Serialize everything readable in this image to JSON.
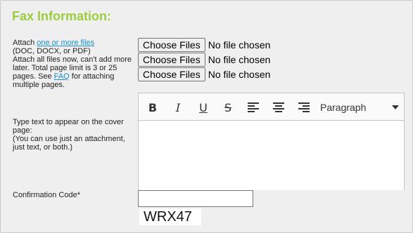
{
  "section": {
    "title": "Fax Information:"
  },
  "attach": {
    "prefix": "Attach ",
    "link": "one or more files",
    "formats": "(DOC, DOCX, or PDF)",
    "note_before_link": "Attach all files now, can't add more later. Total page limit is 3 or 25 pages. See ",
    "faq_link": "FAQ",
    "note_after_link": " for attaching multiple pages."
  },
  "files": [
    {
      "button_label": "Choose Files",
      "status": "No file chosen"
    },
    {
      "button_label": "Choose Files",
      "status": "No file chosen"
    },
    {
      "button_label": "Choose Files",
      "status": "No file chosen"
    }
  ],
  "cover": {
    "label_line1": "Type text to appear on the cover page:",
    "label_line2": "(You can use just an attachment, just text, or both.)"
  },
  "editor": {
    "toolbar": {
      "bold": "B",
      "italic": "I",
      "underline": "U",
      "strike": "S",
      "paragraph": "Paragraph"
    },
    "icons": [
      "bold-icon",
      "italic-icon",
      "underline-icon",
      "strikethrough-icon",
      "align-left-icon",
      "align-center-icon",
      "align-right-icon",
      "dropdown-caret-icon"
    ],
    "text": ""
  },
  "confirmation": {
    "label": "Confirmation Code*",
    "value": "",
    "captcha": "WRX47"
  },
  "colors": {
    "title": "#9ccd3c",
    "link": "#1a8fc9",
    "panel_bg": "#efefef"
  }
}
